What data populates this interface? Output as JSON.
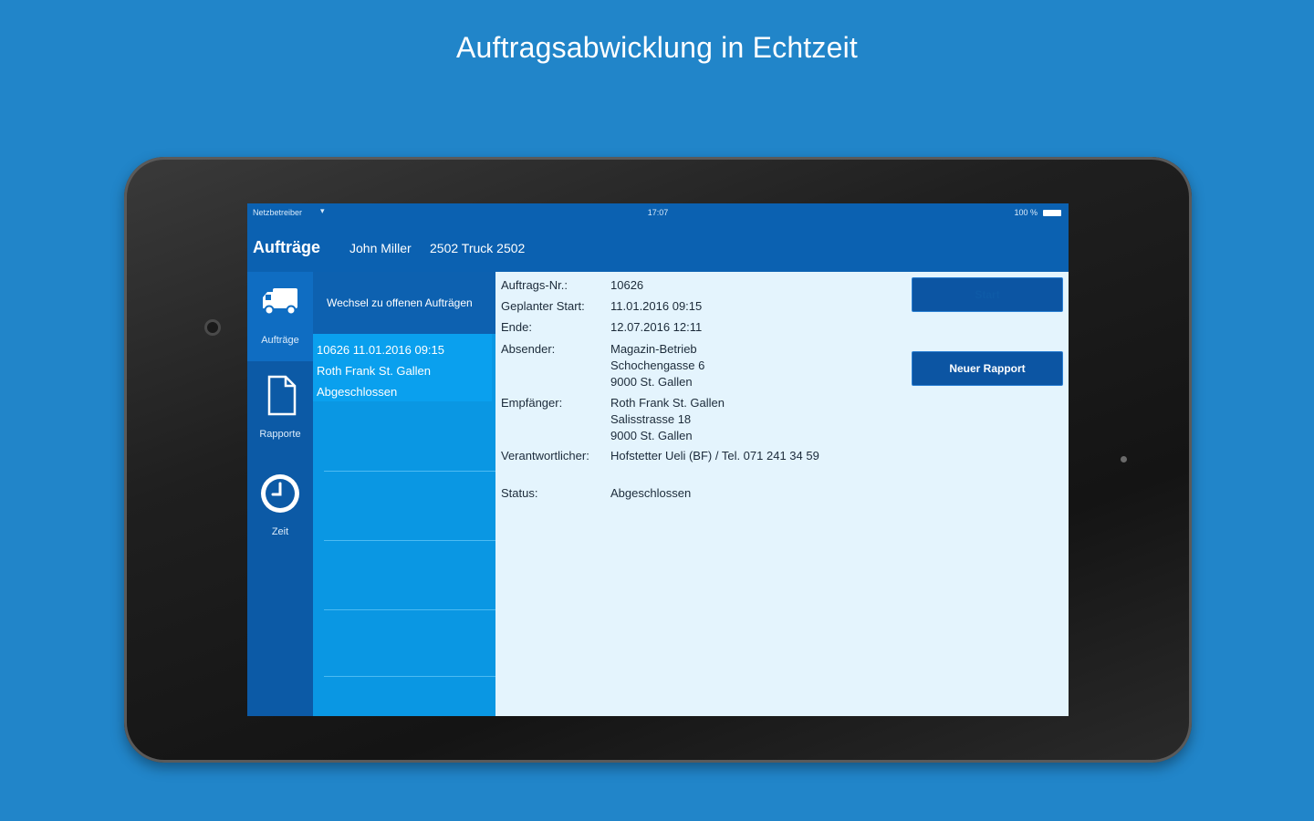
{
  "headline": "Auftragsabwicklung in Echtzeit",
  "status_bar": {
    "carrier": "Netzbetreiber",
    "wifi_icon": "wifi-icon",
    "time": "17:07",
    "battery": "100 %"
  },
  "navbar": {
    "title": "Aufträge",
    "user": "John Miller",
    "vehicle": "2502 Truck 2502"
  },
  "tabs": [
    {
      "label": "Aufträge",
      "icon": "truck-icon",
      "active": true
    },
    {
      "label": "Rapporte",
      "icon": "document-icon",
      "active": false
    },
    {
      "label": "Zeit",
      "icon": "clock-icon",
      "active": false
    }
  ],
  "list": {
    "header": "Wechsel zu offenen Aufträgen",
    "items": [
      {
        "line1": "10626  11.01.2016 09:15",
        "line2": "Roth Frank St. Gallen",
        "line3": "Abgeschlossen"
      }
    ]
  },
  "detail": {
    "order_no_label": "Auftrags-Nr.:",
    "order_no": "10626",
    "planned_start_label": "Geplanter Start:",
    "planned_start": "11.01.2016 09:15",
    "end_label": "Ende:",
    "end": "12.07.2016 12:11",
    "sender_label": "Absender:",
    "sender_lines": [
      "Magazin-Betrieb",
      "Schochengasse 6",
      "9000 St. Gallen"
    ],
    "recipient_label": "Empfänger:",
    "recipient_lines": [
      "Roth Frank St. Gallen",
      "Salisstrasse 18",
      "9000 St. Gallen"
    ],
    "responsible_label": "Verantwortlicher:",
    "responsible": "Hofstetter Ueli (BF) / Tel. 071 241 34 59",
    "status_label": "Status:",
    "status": "Abgeschlossen"
  },
  "buttons": {
    "start": "Start",
    "new_report": "Neuer Rapport"
  },
  "colors": {
    "background": "#2185c9",
    "bar": "#0b61b1",
    "list": "#0a97e3",
    "detail": "#e4f4fd"
  }
}
